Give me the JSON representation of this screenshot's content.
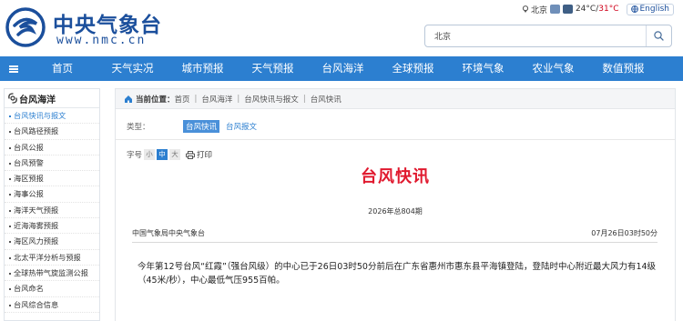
{
  "header": {
    "logo_cn": "中央气象台",
    "logo_en": "www.nmc.cn",
    "weather": {
      "city": "北京",
      "temp_low": "24°C",
      "sep": "/",
      "temp_high": "31°C"
    },
    "language_button": "English",
    "search": {
      "value": "北京",
      "placeholder": ""
    }
  },
  "nav": {
    "items": [
      {
        "label": "首页"
      },
      {
        "label": "天气实况"
      },
      {
        "label": "城市预报"
      },
      {
        "label": "天气预报"
      },
      {
        "label": "台风海洋"
      },
      {
        "label": "全球预报"
      },
      {
        "label": "环境气象"
      },
      {
        "label": "农业气象"
      },
      {
        "label": "数值预报"
      }
    ]
  },
  "sidebar": {
    "title": "台风海洋",
    "items": [
      {
        "label": "台风快讯与报文",
        "active": true
      },
      {
        "label": "台风路径预报"
      },
      {
        "label": "台风公报"
      },
      {
        "label": "台风预警"
      },
      {
        "label": "海区预报"
      },
      {
        "label": "海事公报"
      },
      {
        "label": "海洋天气预报"
      },
      {
        "label": "近海海雾预报"
      },
      {
        "label": "海区风力预报"
      },
      {
        "label": "北太平洋分析与预报"
      },
      {
        "label": "全球热带气旋监测公报"
      },
      {
        "label": "台风命名"
      },
      {
        "label": "台风综合信息"
      }
    ]
  },
  "breadcrumb": {
    "prefix": "当前位置：",
    "items": [
      "首页",
      "台风海洋",
      "台风快讯与报文",
      "台风快讯"
    ]
  },
  "type_filter": {
    "label": "类型：",
    "tags": [
      {
        "label": "台风快讯",
        "active": true
      },
      {
        "label": "台风报文",
        "active": false
      }
    ]
  },
  "font_size": {
    "label": "字号",
    "options": [
      "小",
      "中",
      "大"
    ],
    "selected": "中",
    "print_label": "打印"
  },
  "article": {
    "title": "台风快讯",
    "issue": "2026年总804期",
    "org": "中国气象局中央气象台",
    "date": "07月26日03时50分",
    "body": "今年第12号台风“红霞”（强台风级）的中心已于26日03时50分前后在广东省惠州市惠东县平海镇登陆，登陆时中心附近最大风力有14级（45米/秒），中心最低气压955百帕。"
  },
  "colors": {
    "nav_bg": "#2c7fd0",
    "title_red": "#e0192e",
    "brand_blue": "#1b4f9c"
  }
}
